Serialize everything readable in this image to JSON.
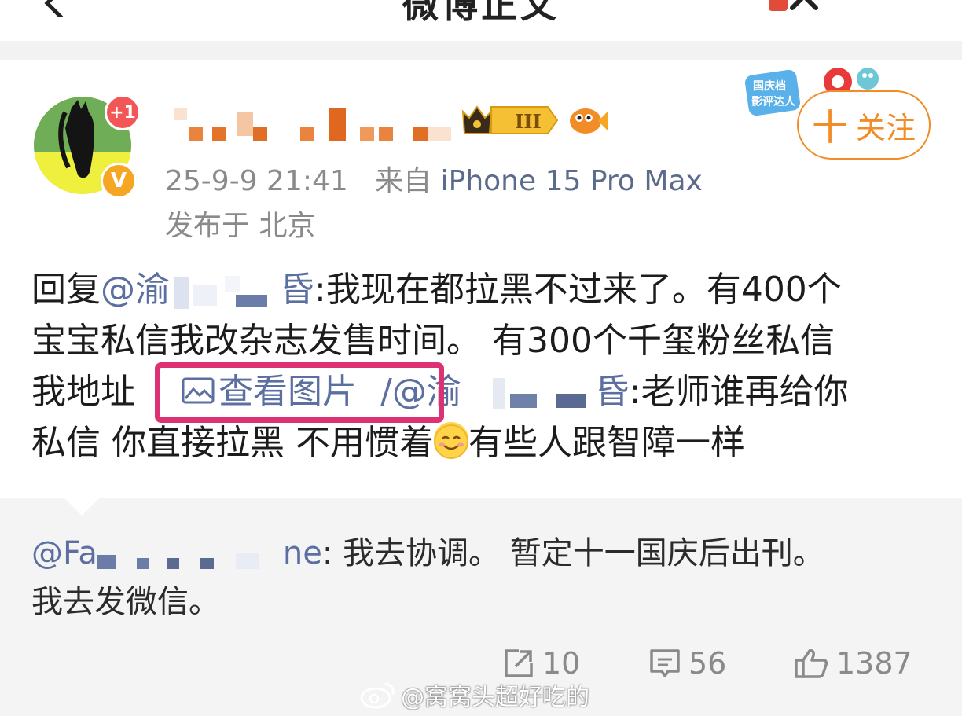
{
  "topbar": {
    "title": "微博正文"
  },
  "post": {
    "avatar_count": "+1",
    "verified_mark": "V",
    "timestamp": "25-9-9 21:41",
    "source_prefix": "来自",
    "source_device": "iPhone 15 Pro Max",
    "location": "发布于 北京",
    "crown_level": "III",
    "follow_label": "关注",
    "follow_plus": "十",
    "event_badge_text": "国庆档 影评达人"
  },
  "body": {
    "line1_prefix": "回复",
    "line1_mention_start": "@渝",
    "line1_mention_end": "昏",
    "line1_text": ":我现在都拉黑不过来了。有400个",
    "line2_text": "宝宝私信我改杂志发售时间。 有300个千玺粉丝私信",
    "line3_prefix": "我地址",
    "image_link_label": "查看图片",
    "line3_sep": "/",
    "line3_mention_start": "/@渝",
    "line3_mention_end": "昏",
    "line3_text": ":老师谁再给你",
    "line4_text_a": "私信 你直接拉黑 不用惯着",
    "line4_text_b": "有些人跟智障一样"
  },
  "quote": {
    "mention_start": "@Fa",
    "mention_end": "ne",
    "line1_text": ": 我去协调。 暂定十一国庆后出刊。",
    "line2_text": "我去发微信。"
  },
  "actions": {
    "repost_count": "10",
    "comment_count": "56",
    "like_count": "1387"
  },
  "watermark": {
    "text": "@窝窝头超好吃的"
  },
  "colors": {
    "accent": "#f28c27",
    "link": "#5b6fa0",
    "highlight": "#dc3173",
    "muted": "#8a8a8a"
  }
}
